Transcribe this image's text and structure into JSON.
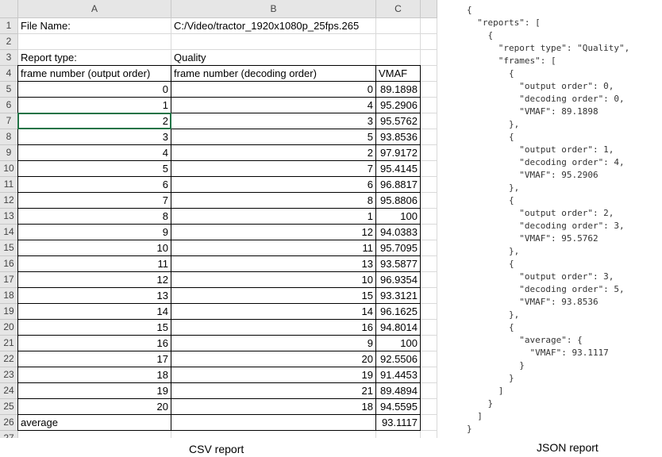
{
  "sheet": {
    "columns": [
      "A",
      "B",
      "C"
    ],
    "rows": [
      {
        "n": "1",
        "a": "File Name:",
        "b": "C:/Video/tractor_1920x1080p_25fps.265",
        "c": ""
      },
      {
        "n": "2",
        "a": "",
        "b": "",
        "c": ""
      },
      {
        "n": "3",
        "a": "Report type:",
        "b": "Quality",
        "c": ""
      },
      {
        "n": "4",
        "a": "frame number (output order)",
        "b": "frame number (decoding order)",
        "c": "VMAF"
      },
      {
        "n": "5",
        "a": "0",
        "b": "0",
        "c": "89.1898"
      },
      {
        "n": "6",
        "a": "1",
        "b": "4",
        "c": "95.2906"
      },
      {
        "n": "7",
        "a": "2",
        "b": "3",
        "c": "95.5762"
      },
      {
        "n": "8",
        "a": "3",
        "b": "5",
        "c": "93.8536"
      },
      {
        "n": "9",
        "a": "4",
        "b": "2",
        "c": "97.9172"
      },
      {
        "n": "10",
        "a": "5",
        "b": "7",
        "c": "95.4145"
      },
      {
        "n": "11",
        "a": "6",
        "b": "6",
        "c": "96.8817"
      },
      {
        "n": "12",
        "a": "7",
        "b": "8",
        "c": "95.8806"
      },
      {
        "n": "13",
        "a": "8",
        "b": "1",
        "c": "100"
      },
      {
        "n": "14",
        "a": "9",
        "b": "12",
        "c": "94.0383"
      },
      {
        "n": "15",
        "a": "10",
        "b": "11",
        "c": "95.7095"
      },
      {
        "n": "16",
        "a": "11",
        "b": "13",
        "c": "93.5877"
      },
      {
        "n": "17",
        "a": "12",
        "b": "10",
        "c": "96.9354"
      },
      {
        "n": "18",
        "a": "13",
        "b": "15",
        "c": "93.3121"
      },
      {
        "n": "19",
        "a": "14",
        "b": "14",
        "c": "96.1625"
      },
      {
        "n": "20",
        "a": "15",
        "b": "16",
        "c": "94.8014"
      },
      {
        "n": "21",
        "a": "16",
        "b": "9",
        "c": "100"
      },
      {
        "n": "22",
        "a": "17",
        "b": "20",
        "c": "92.5506"
      },
      {
        "n": "23",
        "a": "18",
        "b": "19",
        "c": "91.4453"
      },
      {
        "n": "24",
        "a": "19",
        "b": "21",
        "c": "89.4894"
      },
      {
        "n": "25",
        "a": "20",
        "b": "18",
        "c": "94.5595"
      },
      {
        "n": "26",
        "a": "average",
        "b": "",
        "c": "93.1117"
      },
      {
        "n": "27",
        "a": "",
        "b": "",
        "c": ""
      }
    ]
  },
  "captions": {
    "csv": "CSV report",
    "json": "JSON report"
  },
  "json_text": "{\n  \"reports\": [\n    {\n      \"report type\": \"Quality\",\n      \"frames\": [\n        {\n          \"output order\": 0,\n          \"decoding order\": 0,\n          \"VMAF\": 89.1898\n        },\n        {\n          \"output order\": 1,\n          \"decoding order\": 4,\n          \"VMAF\": 95.2906\n        },\n        {\n          \"output order\": 2,\n          \"decoding order\": 3,\n          \"VMAF\": 95.5762\n        },\n        {\n          \"output order\": 3,\n          \"decoding order\": 5,\n          \"VMAF\": 93.8536\n        },\n        {\n          \"average\": {\n            \"VMAF\": 93.1117\n          }\n        }\n      ]\n    }\n  ]\n}"
}
